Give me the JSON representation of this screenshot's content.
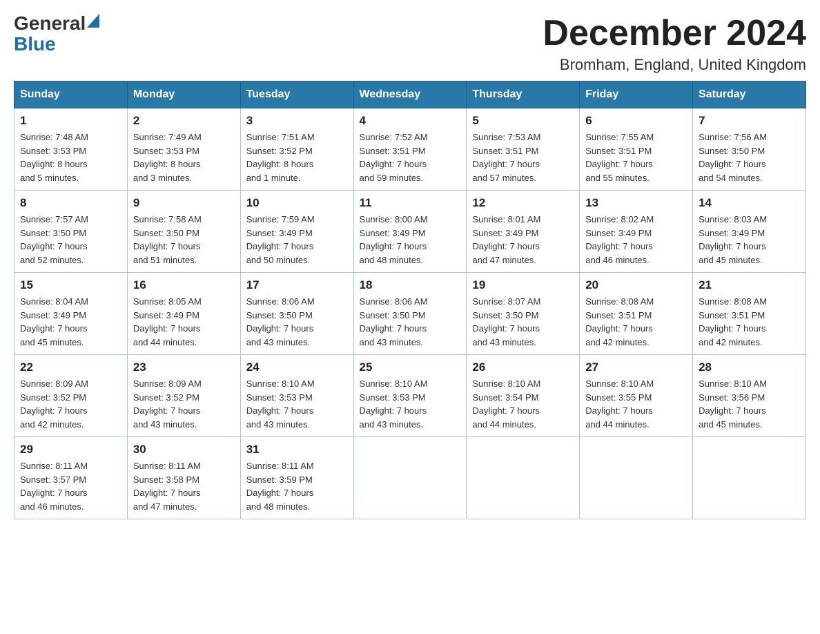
{
  "logo": {
    "general": "General",
    "blue": "Blue"
  },
  "header": {
    "title": "December 2024",
    "location": "Bromham, England, United Kingdom"
  },
  "weekdays": [
    "Sunday",
    "Monday",
    "Tuesday",
    "Wednesday",
    "Thursday",
    "Friday",
    "Saturday"
  ],
  "weeks": [
    [
      {
        "day": "1",
        "sunrise": "7:48 AM",
        "sunset": "3:53 PM",
        "daylight": "8 hours and 5 minutes."
      },
      {
        "day": "2",
        "sunrise": "7:49 AM",
        "sunset": "3:53 PM",
        "daylight": "8 hours and 3 minutes."
      },
      {
        "day": "3",
        "sunrise": "7:51 AM",
        "sunset": "3:52 PM",
        "daylight": "8 hours and 1 minute."
      },
      {
        "day": "4",
        "sunrise": "7:52 AM",
        "sunset": "3:51 PM",
        "daylight": "7 hours and 59 minutes."
      },
      {
        "day": "5",
        "sunrise": "7:53 AM",
        "sunset": "3:51 PM",
        "daylight": "7 hours and 57 minutes."
      },
      {
        "day": "6",
        "sunrise": "7:55 AM",
        "sunset": "3:51 PM",
        "daylight": "7 hours and 55 minutes."
      },
      {
        "day": "7",
        "sunrise": "7:56 AM",
        "sunset": "3:50 PM",
        "daylight": "7 hours and 54 minutes."
      }
    ],
    [
      {
        "day": "8",
        "sunrise": "7:57 AM",
        "sunset": "3:50 PM",
        "daylight": "7 hours and 52 minutes."
      },
      {
        "day": "9",
        "sunrise": "7:58 AM",
        "sunset": "3:50 PM",
        "daylight": "7 hours and 51 minutes."
      },
      {
        "day": "10",
        "sunrise": "7:59 AM",
        "sunset": "3:49 PM",
        "daylight": "7 hours and 50 minutes."
      },
      {
        "day": "11",
        "sunrise": "8:00 AM",
        "sunset": "3:49 PM",
        "daylight": "7 hours and 48 minutes."
      },
      {
        "day": "12",
        "sunrise": "8:01 AM",
        "sunset": "3:49 PM",
        "daylight": "7 hours and 47 minutes."
      },
      {
        "day": "13",
        "sunrise": "8:02 AM",
        "sunset": "3:49 PM",
        "daylight": "7 hours and 46 minutes."
      },
      {
        "day": "14",
        "sunrise": "8:03 AM",
        "sunset": "3:49 PM",
        "daylight": "7 hours and 45 minutes."
      }
    ],
    [
      {
        "day": "15",
        "sunrise": "8:04 AM",
        "sunset": "3:49 PM",
        "daylight": "7 hours and 45 minutes."
      },
      {
        "day": "16",
        "sunrise": "8:05 AM",
        "sunset": "3:49 PM",
        "daylight": "7 hours and 44 minutes."
      },
      {
        "day": "17",
        "sunrise": "8:06 AM",
        "sunset": "3:50 PM",
        "daylight": "7 hours and 43 minutes."
      },
      {
        "day": "18",
        "sunrise": "8:06 AM",
        "sunset": "3:50 PM",
        "daylight": "7 hours and 43 minutes."
      },
      {
        "day": "19",
        "sunrise": "8:07 AM",
        "sunset": "3:50 PM",
        "daylight": "7 hours and 43 minutes."
      },
      {
        "day": "20",
        "sunrise": "8:08 AM",
        "sunset": "3:51 PM",
        "daylight": "7 hours and 42 minutes."
      },
      {
        "day": "21",
        "sunrise": "8:08 AM",
        "sunset": "3:51 PM",
        "daylight": "7 hours and 42 minutes."
      }
    ],
    [
      {
        "day": "22",
        "sunrise": "8:09 AM",
        "sunset": "3:52 PM",
        "daylight": "7 hours and 42 minutes."
      },
      {
        "day": "23",
        "sunrise": "8:09 AM",
        "sunset": "3:52 PM",
        "daylight": "7 hours and 43 minutes."
      },
      {
        "day": "24",
        "sunrise": "8:10 AM",
        "sunset": "3:53 PM",
        "daylight": "7 hours and 43 minutes."
      },
      {
        "day": "25",
        "sunrise": "8:10 AM",
        "sunset": "3:53 PM",
        "daylight": "7 hours and 43 minutes."
      },
      {
        "day": "26",
        "sunrise": "8:10 AM",
        "sunset": "3:54 PM",
        "daylight": "7 hours and 44 minutes."
      },
      {
        "day": "27",
        "sunrise": "8:10 AM",
        "sunset": "3:55 PM",
        "daylight": "7 hours and 44 minutes."
      },
      {
        "day": "28",
        "sunrise": "8:10 AM",
        "sunset": "3:56 PM",
        "daylight": "7 hours and 45 minutes."
      }
    ],
    [
      {
        "day": "29",
        "sunrise": "8:11 AM",
        "sunset": "3:57 PM",
        "daylight": "7 hours and 46 minutes."
      },
      {
        "day": "30",
        "sunrise": "8:11 AM",
        "sunset": "3:58 PM",
        "daylight": "7 hours and 47 minutes."
      },
      {
        "day": "31",
        "sunrise": "8:11 AM",
        "sunset": "3:59 PM",
        "daylight": "7 hours and 48 minutes."
      },
      null,
      null,
      null,
      null
    ]
  ],
  "labels": {
    "sunrise_prefix": "Sunrise: ",
    "sunset_prefix": "Sunset: ",
    "daylight_prefix": "Daylight: "
  }
}
